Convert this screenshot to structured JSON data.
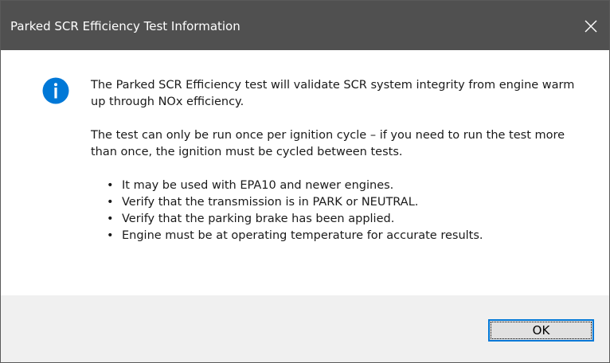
{
  "window": {
    "title": "Parked SCR Efficiency Test Information"
  },
  "icons": {
    "close": "close-icon",
    "info": "info-icon"
  },
  "message": {
    "paragraph1": "The Parked SCR Efficiency test will validate SCR system integrity from engine warm up through NOx efficiency.",
    "paragraph2": "The test can only be run once per ignition cycle – if you need to run the test more than once, the ignition must be cycled between tests.",
    "bullets": [
      "It may be used with EPA10 and newer engines.",
      "Verify that the transmission is in PARK or NEUTRAL.",
      "Verify that the parking brake has been applied.",
      "Engine must be at operating temperature for accurate results."
    ]
  },
  "buttons": {
    "ok_label": "OK"
  },
  "colors": {
    "titlebar": "#505050",
    "info_icon": "#0078d7",
    "footer": "#f0f0f0",
    "button_focus": "#0078d7"
  }
}
